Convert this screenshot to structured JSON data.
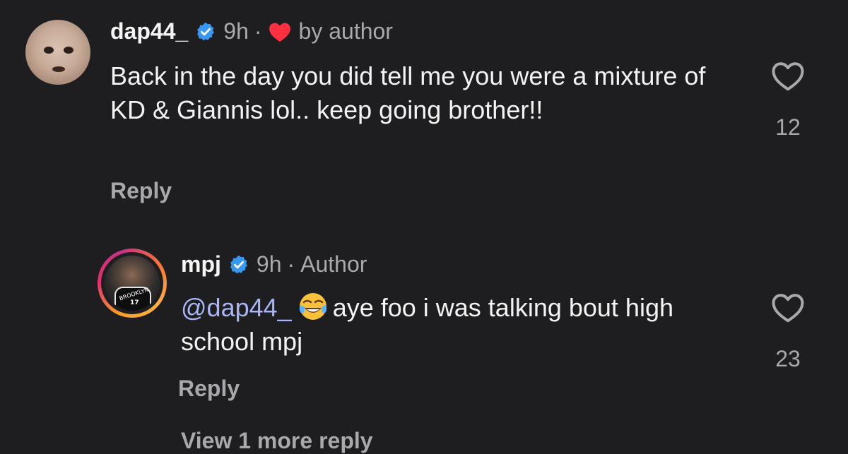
{
  "comments": [
    {
      "username": "dap44_",
      "time": "9h",
      "separator": "·",
      "liked_label": "by author",
      "text": "Back in the day you did tell me you were a mixture of KD & Giannis lol.. keep going brother!!",
      "reply_label": "Reply",
      "likes": "12",
      "avatar_icon": "baby-photo-avatar"
    },
    {
      "username": "mpj",
      "time": "9h",
      "separator": "·",
      "role_label": "Author",
      "mention": "@dap44_",
      "emoji": "tears-of-joy-emoji",
      "text": "aye foo i was talking bout high school mpj",
      "reply_label": "Reply",
      "likes": "23",
      "avatar_icon": "basketball-player-avatar",
      "jersey_text": "BROOKLYN",
      "jersey_number": "17"
    }
  ],
  "view_replies_label": "View 1 more reply",
  "colors": {
    "background": "#1e1e20",
    "verified": "#3897f0",
    "heart": "#ff3040",
    "mention": "#a9b6f6",
    "muted": "#a8a8ad"
  }
}
